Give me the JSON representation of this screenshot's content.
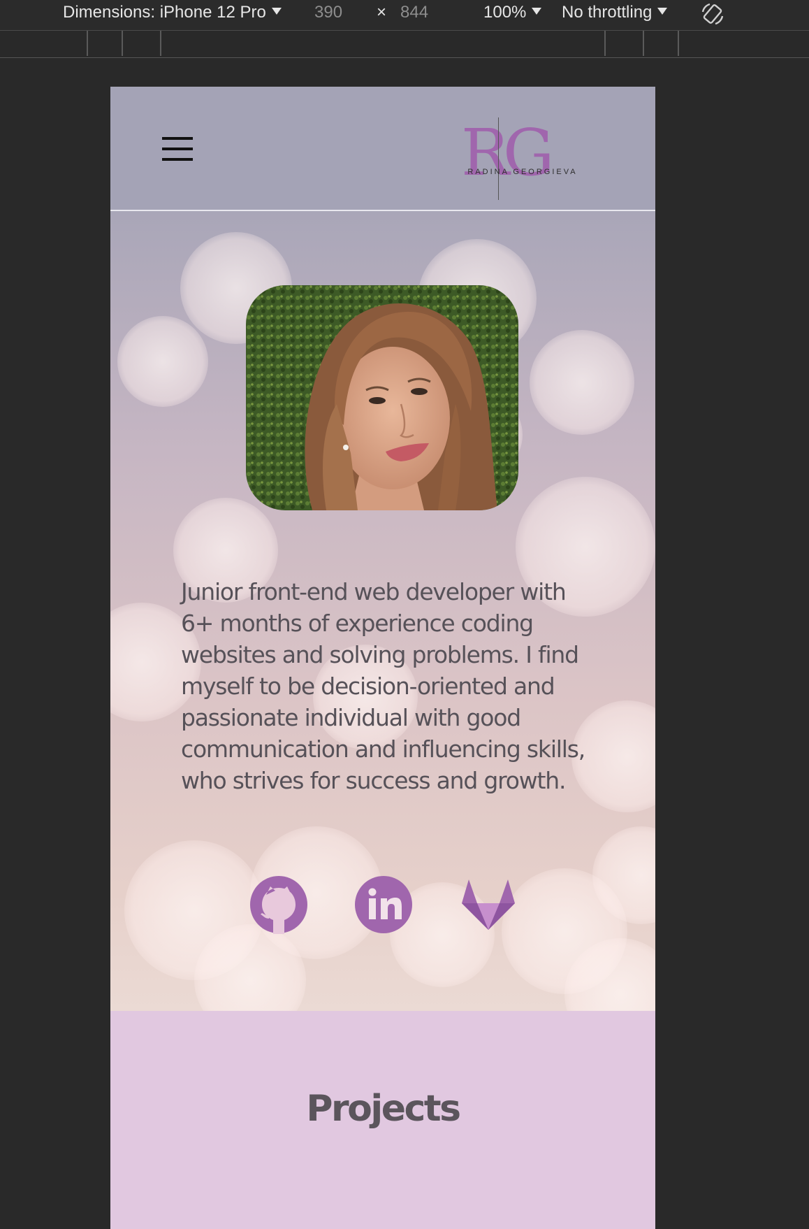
{
  "devtools": {
    "device_label": "Dimensions: iPhone 12 Pro",
    "width": "390",
    "times": "×",
    "height": "844",
    "zoom": "100%",
    "throttling": "No throttling",
    "rotate_icon": "rotate-device-icon"
  },
  "header": {
    "menu_icon": "hamburger-menu-icon",
    "logo_letters": "R",
    "logo_letter_2": "G",
    "logo_text": "RADINA GEORGIEVA",
    "colors": {
      "background": "#a4a3b6",
      "logo": "#a066ad"
    }
  },
  "hero": {
    "bio": "Junior front-end web developer with 6+ months of experience coding websites and solving problems. I find myself to be decision-oriented and passionate individual with good communication and influencing skills, who strives for success and growth.",
    "social": [
      {
        "icon": "github-icon"
      },
      {
        "icon": "linkedin-icon"
      },
      {
        "icon": "gitlab-icon"
      }
    ],
    "colors": {
      "text": "#565158",
      "icon": "#a066ad"
    }
  },
  "projects": {
    "title": "Projects",
    "colors": {
      "background": "#e1c8e0"
    }
  }
}
